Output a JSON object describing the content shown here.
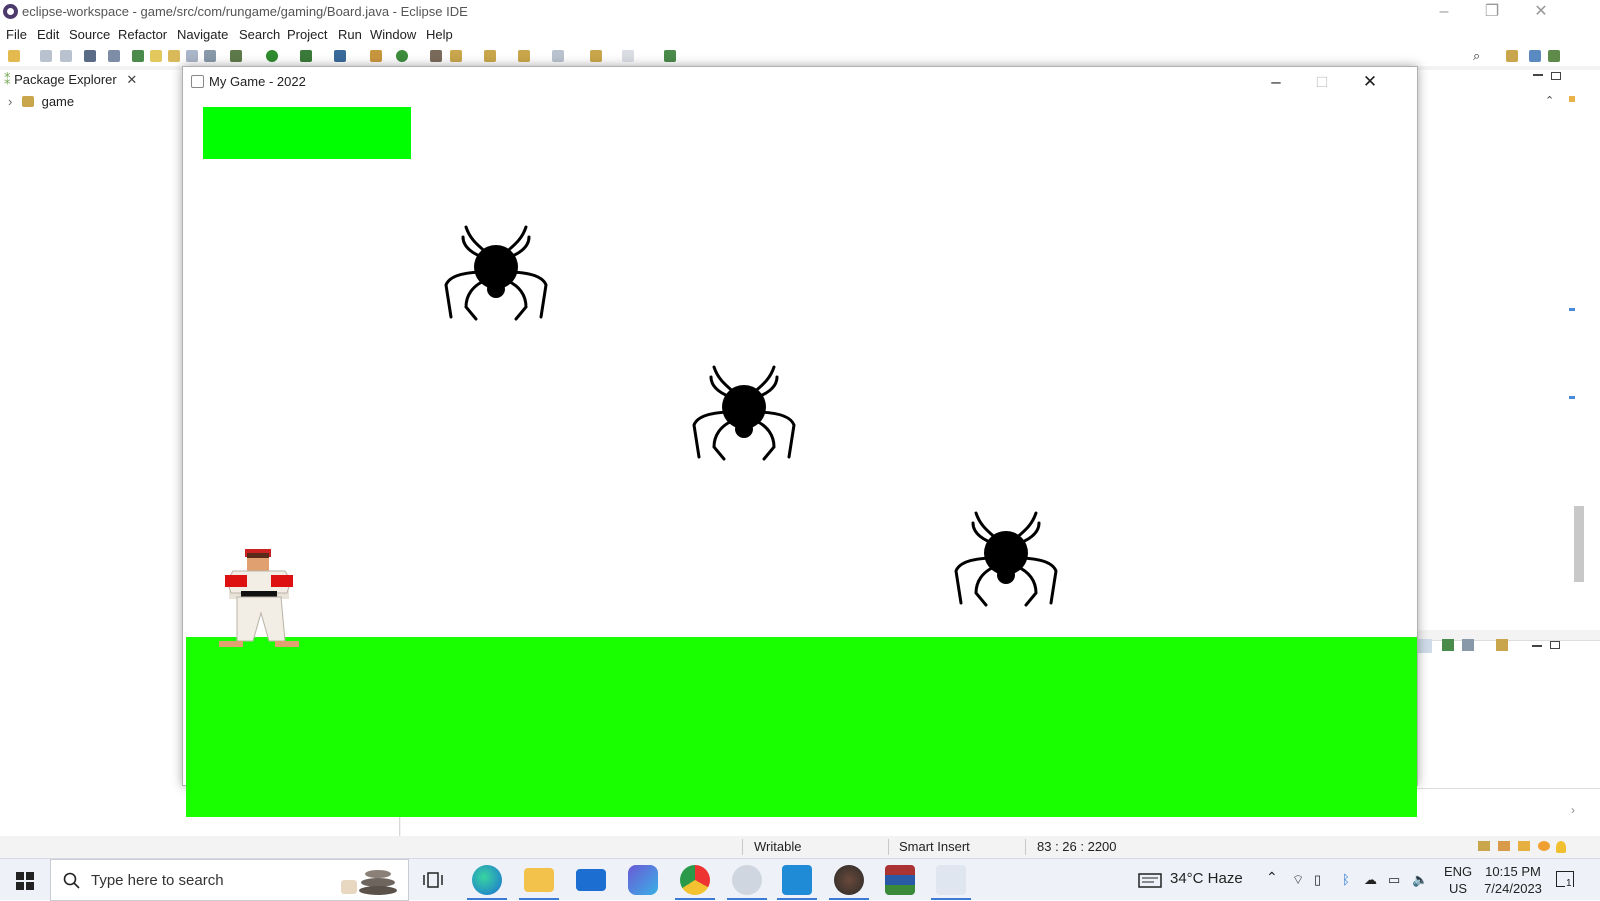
{
  "window": {
    "title": "eclipse-workspace - game/src/com/rungame/gaming/Board.java - Eclipse IDE"
  },
  "menu": [
    "File",
    "Edit",
    "Source",
    "Refactor",
    "Navigate",
    "Search",
    "Project",
    "Run",
    "Window",
    "Help"
  ],
  "package_explorer": {
    "tab_label": "Package Explorer",
    "items": [
      {
        "label": "game"
      }
    ]
  },
  "game_window": {
    "title": "My Game - 2022",
    "health_color": "#00ff00",
    "ground_color": "#1aff00"
  },
  "statusbar": {
    "writable": "Writable",
    "insert_mode": "Smart Insert",
    "position": "83 : 26 : 2200"
  },
  "taskbar": {
    "search_placeholder": "Type here to search",
    "weather": "34°C  Haze",
    "lang_top": "ENG",
    "lang_bottom": "US",
    "time": "10:15 PM",
    "date": "7/24/2023",
    "notification_count": "1"
  }
}
